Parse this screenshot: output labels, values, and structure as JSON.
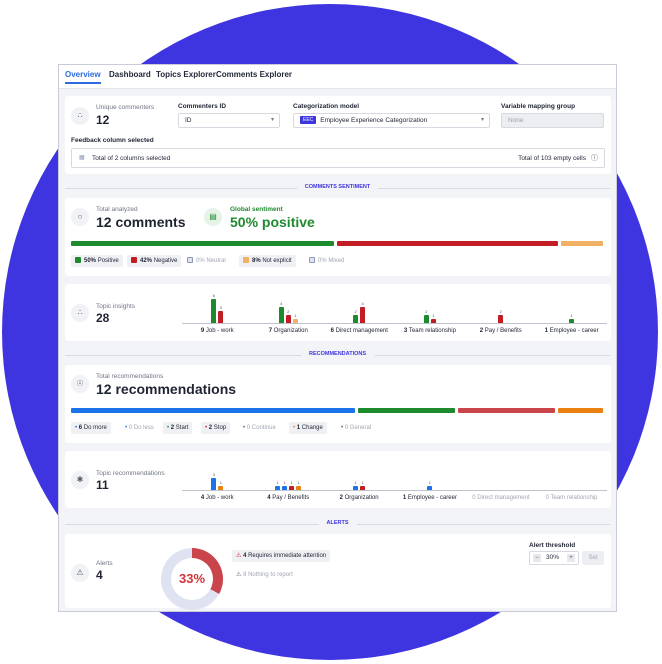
{
  "tabs": [
    "Overview",
    "Dashboard",
    "Topics Explorer",
    "Comments Explorer"
  ],
  "header": {
    "unique_commenters_label": "Unique commenters",
    "unique_commenters_value": "12",
    "commenters_id_label": "Commenters ID",
    "commenters_id_value": "ID",
    "categorization_model_label": "Categorization model",
    "categorization_model_badge": "EEC",
    "categorization_model_value": "Employee Experience Categorization",
    "variable_mapping_label": "Variable mapping group",
    "variable_mapping_placeholder": "None",
    "feedback_column_label": "Feedback column selected",
    "columns_selected": "Total of 2 columns selected",
    "empty_cells": "Total of 103 empty cells"
  },
  "sections": {
    "sentiment": "COMMENTS SENTIMENT",
    "recommendations": "RECOMMENDATIONS",
    "alerts": "ALERTS"
  },
  "sentiment": {
    "total_label": "Total analyzed",
    "total_value": "12 comments",
    "global_label": "Global sentiment",
    "global_value": "50% positive",
    "bar": [
      {
        "name": "Positive",
        "pct": 50,
        "color": "#1e8a2e"
      },
      {
        "name": "Negative",
        "pct": 42,
        "color": "#c21d24"
      },
      {
        "name": "Not explicit",
        "pct": 8,
        "color": "#f0b164"
      }
    ],
    "legend": [
      {
        "pct": "50%",
        "label": "Positive",
        "muted": false,
        "color": "#1e8a2e"
      },
      {
        "pct": "42%",
        "label": "Negative",
        "muted": false,
        "color": "#c21d24"
      },
      {
        "pct": "0%",
        "label": "Neutral",
        "muted": true,
        "color": "#8e99b8"
      },
      {
        "pct": "8%",
        "label": "Not explicit",
        "muted": false,
        "color": "#f0b164"
      },
      {
        "pct": "0%",
        "label": "Mixed",
        "muted": true,
        "color": "#8e99b8"
      }
    ]
  },
  "topic_insights": {
    "label": "Topic insights",
    "value": "28",
    "topics": [
      {
        "count": "9",
        "name": "Job - work",
        "bars": [
          {
            "v": 6,
            "c": "#1e8a2e"
          },
          {
            "v": 3,
            "c": "#c21d24"
          }
        ]
      },
      {
        "count": "7",
        "name": "Organization",
        "bars": [
          {
            "v": 4,
            "c": "#1e8a2e"
          },
          {
            "v": 2,
            "c": "#c21d24"
          },
          {
            "v": 1,
            "c": "#f0b164"
          }
        ]
      },
      {
        "count": "6",
        "name": "Direct management",
        "bars": [
          {
            "v": 2,
            "c": "#1e8a2e"
          },
          {
            "v": 4,
            "c": "#c21d24"
          }
        ]
      },
      {
        "count": "3",
        "name": "Team relationship",
        "bars": [
          {
            "v": 2,
            "c": "#1e8a2e"
          },
          {
            "v": 1,
            "c": "#c21d24"
          }
        ]
      },
      {
        "count": "2",
        "name": "Pay / Benefits",
        "bars": [
          {
            "v": 2,
            "c": "#c21d24"
          }
        ]
      },
      {
        "count": "1",
        "name": "Employee - career",
        "bars": [
          {
            "v": 1,
            "c": "#1e8a2e"
          }
        ]
      }
    ]
  },
  "recommendations": {
    "total_label": "Total recommendations",
    "total_value": "12 recommendations",
    "bar": [
      {
        "name": "Do more",
        "pct": 50,
        "color": "#1a73e8"
      },
      {
        "name": "Start",
        "pct": 17,
        "color": "#1e8a2e"
      },
      {
        "name": "Stop",
        "pct": 17,
        "color": "#c9454b"
      },
      {
        "name": "Change",
        "pct": 8,
        "color": "#e8810f"
      }
    ],
    "legend": [
      {
        "count": "6",
        "label": "Do more",
        "muted": false,
        "color": "#1a73e8"
      },
      {
        "count": "0",
        "label": "Do less",
        "muted": true,
        "color": "#1a73e8"
      },
      {
        "count": "2",
        "label": "Start",
        "muted": false,
        "color": "#1e8a2e"
      },
      {
        "count": "2",
        "label": "Stop",
        "muted": false,
        "color": "#c21d24"
      },
      {
        "count": "0",
        "label": "Continue",
        "muted": true,
        "color": "#555b6b"
      },
      {
        "count": "1",
        "label": "Change",
        "muted": false,
        "color": "#e8810f"
      },
      {
        "count": "0",
        "label": "General",
        "muted": true,
        "color": "#555b6b"
      }
    ]
  },
  "topic_recommendations": {
    "label": "Topic recommendations",
    "value": "11",
    "topics": [
      {
        "count": "4",
        "name": "Job - work",
        "muted": false,
        "bars": [
          {
            "v": 3,
            "c": "#1a73e8"
          },
          {
            "v": 1,
            "c": "#e8810f"
          }
        ]
      },
      {
        "count": "4",
        "name": "Pay / Benefits",
        "muted": false,
        "bars": [
          {
            "v": 1,
            "c": "#1a73e8"
          },
          {
            "v": 1,
            "c": "#1a73e8"
          },
          {
            "v": 1,
            "c": "#c21d24"
          },
          {
            "v": 1,
            "c": "#e8810f"
          }
        ]
      },
      {
        "count": "2",
        "name": "Organization",
        "muted": false,
        "bars": [
          {
            "v": 1,
            "c": "#1a73e8"
          },
          {
            "v": 1,
            "c": "#c21d24"
          }
        ]
      },
      {
        "count": "1",
        "name": "Employee - career",
        "muted": false,
        "bars": [
          {
            "v": 1,
            "c": "#1a73e8"
          }
        ]
      },
      {
        "count": "0",
        "name": "Direct management",
        "muted": true,
        "bars": []
      },
      {
        "count": "0",
        "name": "Team relationship",
        "muted": true,
        "bars": []
      }
    ]
  },
  "alerts": {
    "label": "Alerts",
    "value": "4",
    "donut_pct": 33,
    "donut_text": "33%",
    "donut_color": "#c9454b",
    "donut_rest_color": "#dfe3f1",
    "items": [
      {
        "count": "4",
        "text": "Requires immediate attention",
        "muted": false
      },
      {
        "count": "8",
        "text": "Nothing to report",
        "muted": true
      }
    ],
    "threshold_label": "Alert threshold",
    "threshold_value": "30%",
    "set_label": "Set"
  }
}
